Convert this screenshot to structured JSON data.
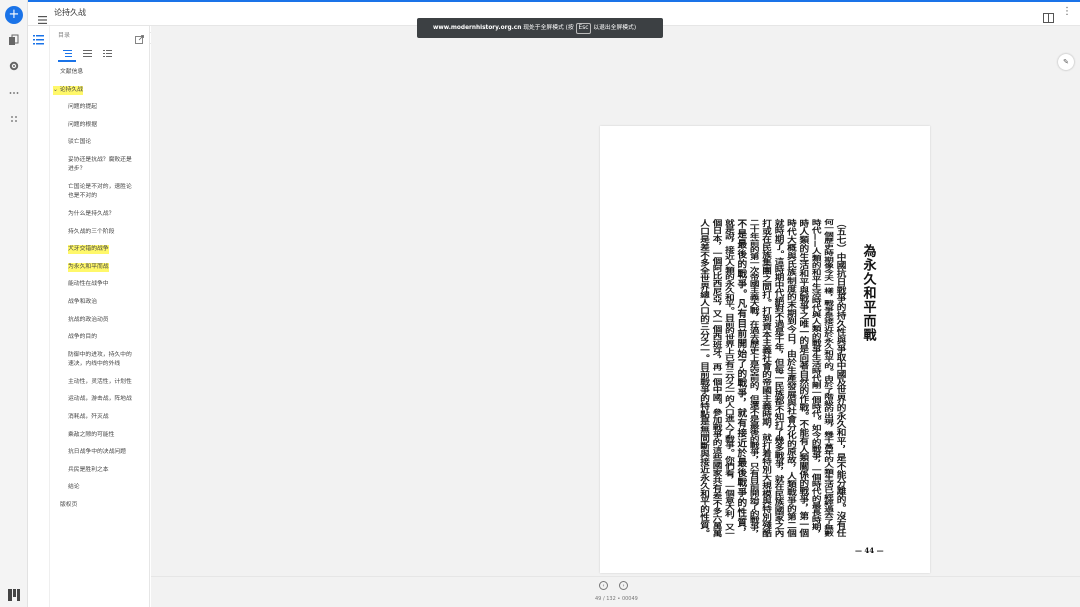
{
  "app": {
    "doc_title": "论持久战",
    "fab_label": "+",
    "page_nav": {
      "current": "49",
      "total": "132",
      "code": "00049"
    }
  },
  "sidebar": {
    "panel_label": "目录"
  },
  "toc": [
    {
      "label": "文献信息",
      "level": "top",
      "highlight": false
    },
    {
      "label": "论持久战",
      "level": "top",
      "highlight": true,
      "expanded": true
    },
    {
      "label": "问题的提起",
      "level": "sub",
      "highlight": false
    },
    {
      "label": "问题的根据",
      "level": "sub",
      "highlight": false
    },
    {
      "label": "驳亡国论",
      "level": "sub",
      "highlight": false
    },
    {
      "label": "妥协还是抗战？腐败还是进步？",
      "level": "sub",
      "highlight": false
    },
    {
      "label": "亡国论是不对的，速胜论也是不对的",
      "level": "sub",
      "highlight": false
    },
    {
      "label": "为什么是持久战？",
      "level": "sub",
      "highlight": false
    },
    {
      "label": "持久战的三个阶段",
      "level": "sub",
      "highlight": false
    },
    {
      "label": "犬牙交错的战争",
      "level": "sub",
      "highlight": true
    },
    {
      "label": "为永久和平而战",
      "level": "sub",
      "highlight": true
    },
    {
      "label": "能动性在战争中",
      "level": "sub",
      "highlight": false
    },
    {
      "label": "战争和政治",
      "level": "sub",
      "highlight": false
    },
    {
      "label": "抗战的政治动员",
      "level": "sub",
      "highlight": false
    },
    {
      "label": "战争的目的",
      "level": "sub",
      "highlight": false
    },
    {
      "label": "防御中的进攻，持久中的速决，内线中的外线",
      "level": "sub",
      "highlight": false
    },
    {
      "label": "主动性，灵活性，计划性",
      "level": "sub",
      "highlight": false
    },
    {
      "label": "运动战，游击战，阵地战",
      "level": "sub",
      "highlight": false
    },
    {
      "label": "消耗战，歼灭战",
      "level": "sub",
      "highlight": false
    },
    {
      "label": "乘敌之隙的可能性",
      "level": "sub",
      "highlight": false
    },
    {
      "label": "抗日战争中的决战问题",
      "level": "sub",
      "highlight": false
    },
    {
      "label": "兵民是胜利之本",
      "level": "sub",
      "highlight": false
    },
    {
      "label": "结论",
      "level": "sub",
      "highlight": false
    },
    {
      "label": "版权页",
      "level": "top",
      "highlight": false
    }
  ],
  "toast": {
    "site": "www.modernhistory.org.cn",
    "before_key": " 现处于全屏模式 (按",
    "key": "Esc",
    "after_key": "以退出全屏模式)"
  },
  "scan": {
    "heading": "為永久和平而戰",
    "page_number": "— 44 —",
    "columns": [
      "（五七）中國抗日戰爭的持久性與爭取中國及世界的永久和平，是不能分離的。沒有任",
      "何一個歷史時期像今天一樣，戰爭是接近於永久和平的。由於了階級的出現，幾千萬年的人類生活已經經過去了無數",
      "時代——人類的和平生活時代與人類的戰爭生活時代剛一個時代。如今的戰爭，一個時代的最長時期，",
      "時人類的生活和平與戰爭之唯一的是向著自然的作戰。不能有人類關係的戰爭，第一個",
      "時代大概與氏族制度的末期到今日，由於生產發展與社會分化的原故，人類戰爭的第二個",
      "就時期了。這時期中代絕對不過是千年，但每一民族都不知打了幾多戰爭，就在民族國家之內",
      "打或在民族集團之間打。打到資本主義社會的帝國主義時期，就打着特別大規模與特別殘酷",
      "二十年前的第一次帝國主義大戰，在過去歷史上是空前的，但還不是最後的戰爭，只有目前開始了的戰爭，",
      "不是最後的戰爭。凡有目前開始了的戰爭，就有接近於最後戰爭的性質，",
      "就是說，接近人類的永久和平。目前的世界上已有三分之一的人口進入了戰爭。你們看，一個意大利，又一",
      "個日本，一個阿比西尼亞，又一個西班牙，再一個中國。參加戰爭的這些國家共有差不多六萬萬",
      "人口是差不多全世界總人口的三分之一。目前戰爭的特點是無間斷與接近永久和平的性質。"
    ]
  }
}
